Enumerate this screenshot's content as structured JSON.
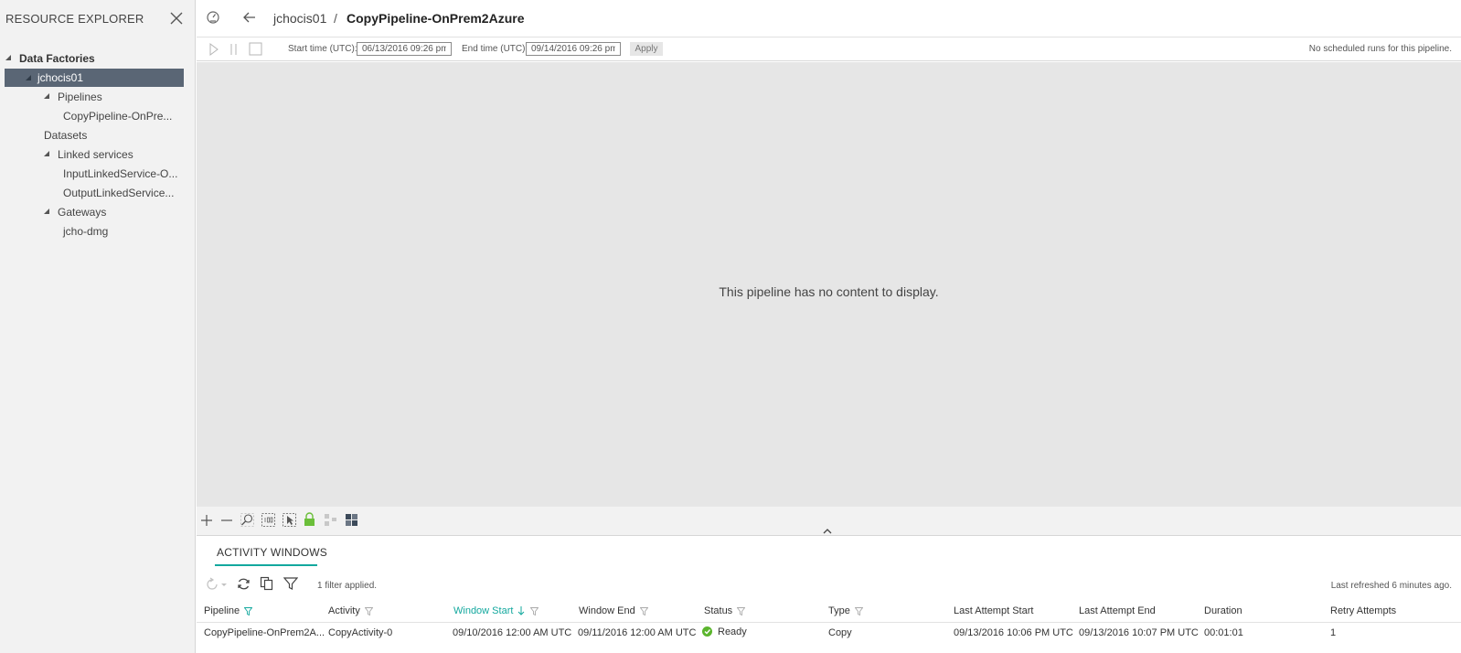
{
  "sidebar": {
    "title": "RESOURCE EXPLORER",
    "tree": {
      "root": "Data Factories",
      "factory": "jchocis01",
      "pipelines": "Pipelines",
      "pipeline_item": "CopyPipeline-OnPre...",
      "datasets": "Datasets",
      "linked_services": "Linked services",
      "linked_input": "InputLinkedService-O...",
      "linked_output": "OutputLinkedService...",
      "gateways": "Gateways",
      "gateway_item": "jcho-dmg"
    }
  },
  "header": {
    "breadcrumb_parent": "jchocis01",
    "breadcrumb_sep": "/",
    "breadcrumb_current": "CopyPipeline-OnPrem2Azure"
  },
  "toolbar": {
    "start_label": "Start time (UTC):",
    "start_value": "06/13/2016 09:26 pm",
    "end_label": "End time (UTC):",
    "end_value": "09/14/2016 09:26 pm",
    "apply_label": "Apply",
    "status_text": "No scheduled runs for this pipeline."
  },
  "canvas": {
    "message": "This pipeline has no content to display."
  },
  "activity": {
    "tab_label": "ACTIVITY WINDOWS",
    "filter_text": "1 filter applied.",
    "refresh_text": "Last refreshed 6 minutes ago.",
    "columns": [
      "Pipeline",
      "Activity",
      "Window Start",
      "Window End",
      "Status",
      "Type",
      "Last Attempt Start",
      "Last Attempt End",
      "Duration",
      "Retry Attempts"
    ],
    "rows": [
      {
        "pipeline": "CopyPipeline-OnPrem2A...",
        "activity": "CopyActivity-0",
        "window_start": "09/10/2016 12:00 AM UTC",
        "window_end": "09/11/2016 12:00 AM UTC",
        "status": "Ready",
        "type": "Copy",
        "last_attempt_start": "09/13/2016 10:06 PM UTC",
        "last_attempt_end": "09/13/2016 10:07 PM UTC",
        "duration": "00:01:01",
        "retry_attempts": "1"
      }
    ]
  },
  "colors": {
    "accent": "#13a89e",
    "selected_bg": "#5a6675",
    "status_ready": "#5bb52d",
    "canvas_bg": "#e6e6e6"
  },
  "icons": {
    "close": "close-icon",
    "monitor": "monitor-gauge-icon",
    "back": "back-arrow-icon",
    "play": "play-icon",
    "pause": "pause-icon",
    "stop": "stop-icon",
    "zoom_in": "zoom-in-icon",
    "zoom_out": "zoom-out-icon",
    "zoom_fit": "zoom-to-fit-icon",
    "zoom_100": "zoom-100-icon",
    "select": "select-icon",
    "lock": "lock-icon",
    "layout": "auto-layout-icon",
    "minimap": "minimap-icon",
    "rerun": "rerun-icon",
    "refresh": "refresh-icon",
    "copy": "copy-icon",
    "filter": "filter-icon"
  }
}
